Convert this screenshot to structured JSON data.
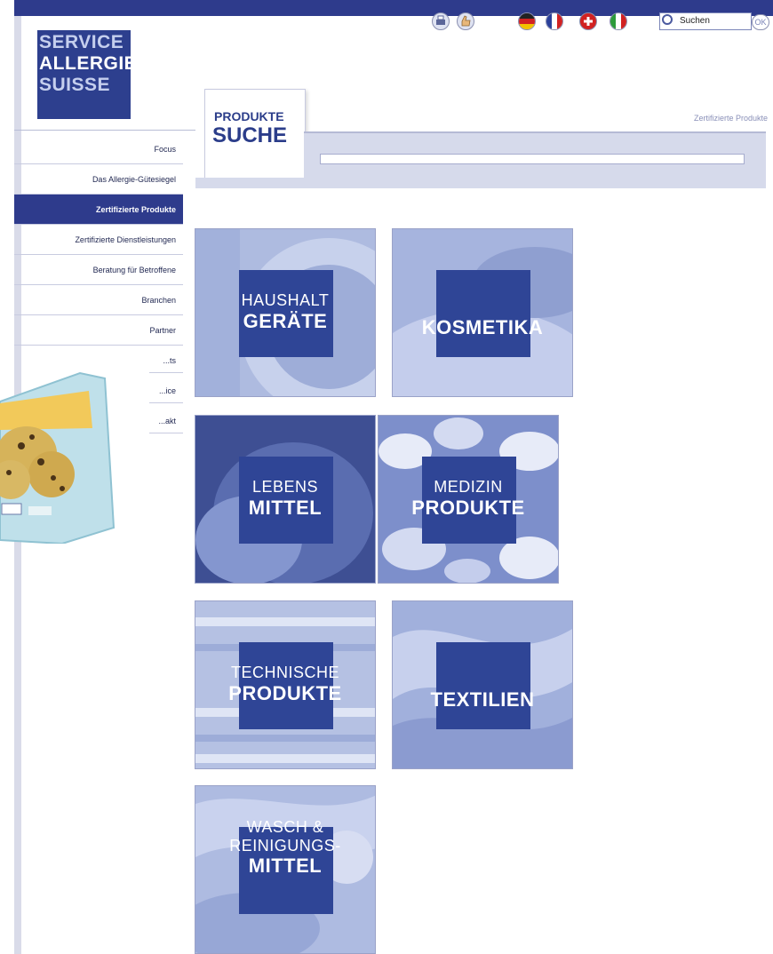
{
  "logo": {
    "line1": "SERVICE",
    "line2": "ALLERGIE",
    "line3": "SUISSE"
  },
  "toolbar": {
    "icons": [
      "print-icon",
      "thumbs-up-icon"
    ]
  },
  "languages": [
    "flag-de-icon",
    "flag-fr-icon",
    "flag-ch-icon",
    "flag-it-icon"
  ],
  "search": {
    "value": "Suchen",
    "ok_label": "OK"
  },
  "breadcrumb": "Zertifizierte Produkte",
  "search_panel": {
    "title_small": "PRODUKTE",
    "title_big": "SUCHE"
  },
  "nav": {
    "items": [
      {
        "label": "Focus"
      },
      {
        "label": "Das Allergie-Gütesiegel"
      },
      {
        "label": "Zertifizierte Produkte",
        "active": true
      },
      {
        "label": "Zertifizierte Dienstleistungen"
      },
      {
        "label": "Beratung für Betroffene"
      },
      {
        "label": "Branchen"
      },
      {
        "label": "Partner"
      }
    ],
    "partial": [
      "...ts",
      "...ice",
      "...akt"
    ]
  },
  "categories": [
    {
      "line1": "HAUSHALT",
      "line2": "GERÄTE"
    },
    {
      "line1": "",
      "line2": "KOSMETIKA"
    },
    {
      "line1": "LEBENS",
      "line2": "MITTEL"
    },
    {
      "line1": "MEDIZIN",
      "line2": "PRODUKTE"
    },
    {
      "line1": "TECHNISCHE",
      "line2": "PRODUKTE"
    },
    {
      "line1": "",
      "line2": "TEXTILIEN"
    },
    {
      "line1": "WASCH &",
      "line1b": "REINIGUNGS-",
      "line2": "MITTEL"
    }
  ]
}
